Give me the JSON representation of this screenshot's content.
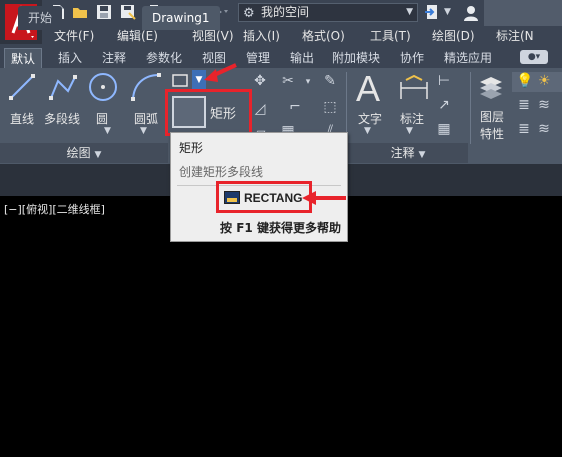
{
  "title_bar": {
    "workspace_label": "我的空间",
    "quick_access_icons": [
      "new-icon",
      "open-icon",
      "save-icon",
      "save-as-icon",
      "print-icon",
      "undo-icon",
      "redo-icon",
      "gear-icon",
      "share-icon",
      "user-icon"
    ]
  },
  "menu": {
    "items": [
      "文件(F)",
      "编辑(E)",
      "视图(V)",
      "插入(I)",
      "格式(O)",
      "工具(T)",
      "绘图(D)",
      "标注(N"
    ]
  },
  "ribbon_tabs": {
    "items": [
      "默认",
      "插入",
      "注释",
      "参数化",
      "视图",
      "管理",
      "输出",
      "附加模块",
      "协作",
      "精选应用"
    ],
    "active": "默认"
  },
  "draw_panel": {
    "tools": [
      "直线",
      "多段线",
      "圆",
      "圆弧"
    ],
    "rect_label": "矩形",
    "polygon_label_partial": "多",
    "footer": "绘图"
  },
  "annotation_panel": {
    "big_letter": "A",
    "tools": [
      "文字",
      "标注"
    ],
    "footer": "注释"
  },
  "layer_panel": {
    "label_line1": "图层",
    "label_line2": "特性"
  },
  "doc_tabs": {
    "start": "开始",
    "drawing": "Drawing1"
  },
  "viewport": {
    "label": "[−][俯视][二维线框]"
  },
  "tooltip": {
    "title": "矩形",
    "description": "创建矩形多段线",
    "command": "RECTANG",
    "help_prefix": "按",
    "help_key": "F1",
    "help_suffix": "键获得更多帮助"
  },
  "colors": {
    "accent_red": "#e8232b",
    "ribbon_bg": "#4e5968",
    "title_bg": "#3b4453",
    "canvas_bg": "#000000"
  }
}
